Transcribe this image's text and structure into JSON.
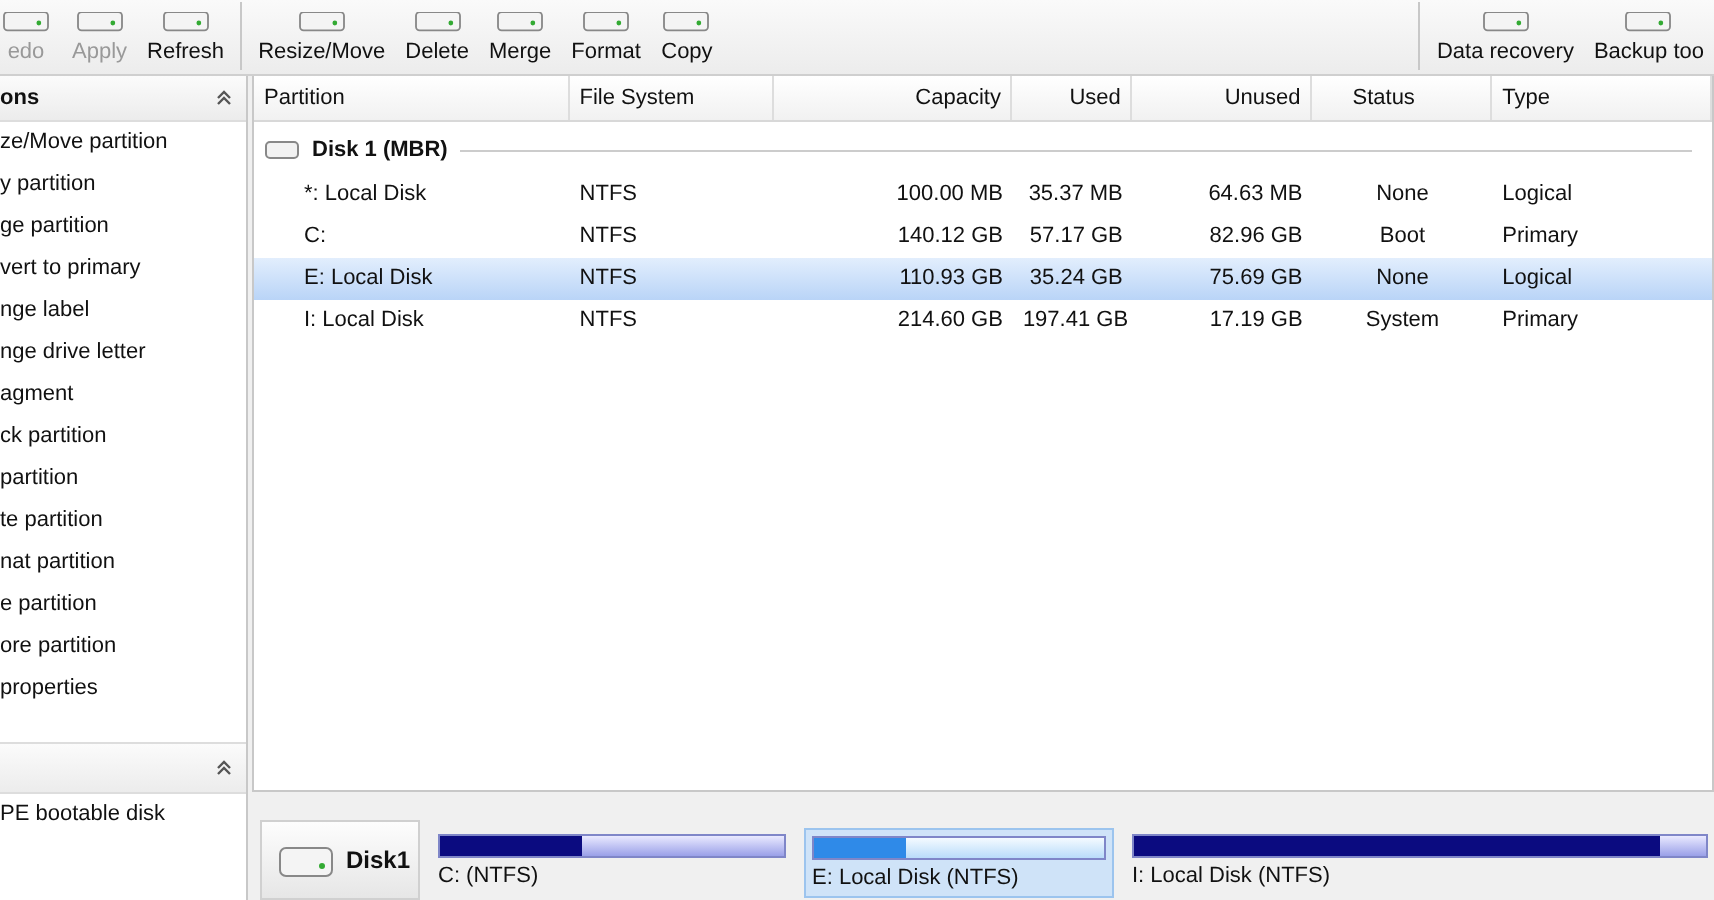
{
  "toolbar": {
    "left": [
      {
        "label": "edo",
        "disabled": true
      },
      {
        "label": "Apply",
        "disabled": true
      },
      {
        "label": "Refresh",
        "disabled": false
      }
    ],
    "partition_tools": [
      {
        "label": "Resize/Move",
        "disabled": false
      },
      {
        "label": "Delete",
        "disabled": false
      },
      {
        "label": "Merge",
        "disabled": false
      },
      {
        "label": "Format",
        "disabled": false
      },
      {
        "label": "Copy",
        "disabled": false
      }
    ],
    "right": [
      {
        "label": "Data recovery",
        "disabled": false
      },
      {
        "label": "Backup too",
        "disabled": false
      }
    ]
  },
  "sidebar": {
    "sections": [
      {
        "title": "ons",
        "items": [
          "ze/Move partition",
          "y partition",
          "ge partition",
          "vert to primary",
          "nge label",
          "nge drive letter",
          "agment",
          "ck partition",
          "partition",
          "te partition",
          "nat partition",
          "e partition",
          "ore partition",
          "properties"
        ]
      },
      {
        "items": [
          "PE bootable disk"
        ]
      }
    ]
  },
  "table": {
    "columns": [
      "Partition",
      "File System",
      "Capacity",
      "Used",
      "Unused",
      "Status",
      "Type"
    ],
    "disk": "Disk 1 (MBR)",
    "rows": [
      {
        "cells": [
          "*: Local Disk",
          "NTFS",
          "100.00 MB",
          "35.37 MB",
          "64.63 MB",
          "None",
          "Logical"
        ],
        "selected": false
      },
      {
        "cells": [
          "C:",
          "NTFS",
          "140.12 GB",
          "57.17 GB",
          "82.96 GB",
          "Boot",
          "Primary"
        ],
        "selected": false
      },
      {
        "cells": [
          "E: Local Disk",
          "NTFS",
          "110.93 GB",
          "35.24 GB",
          "75.69 GB",
          "None",
          "Logical"
        ],
        "selected": true
      },
      {
        "cells": [
          "I: Local Disk",
          "NTFS",
          "214.60 GB",
          "197.41 GB",
          "17.19 GB",
          "System",
          "Primary"
        ],
        "selected": false
      }
    ]
  },
  "disk_map": {
    "disk": "Disk1",
    "partitions": [
      {
        "label": "C: (NTFS)",
        "level": 0.41,
        "selected": false
      },
      {
        "label": "E: Local Disk (NTFS)",
        "level": 0.32,
        "selected": true
      },
      {
        "label": "I: Local Disk (NTFS)",
        "level": 0.92,
        "selected": false
      }
    ]
  }
}
